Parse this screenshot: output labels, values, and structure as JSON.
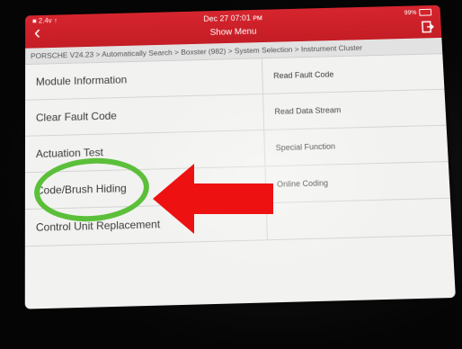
{
  "status_bar": {
    "indicators": "■ 2.4ᴠ ↑",
    "battery": "99%"
  },
  "header": {
    "datetime": "Dec 27  07:01 ᴘᴍ",
    "title": "Show Menu",
    "back_icon": "chevron-left-icon",
    "exit_icon": "exit-icon",
    "color": "#d6252e"
  },
  "breadcrumb": "PORSCHE V24.23 > Automatically Search > Boxster (982) > System Selection > Instrument Cluster",
  "menu": {
    "left": [
      "Module Information",
      "Clear Fault Code",
      "Actuation Test",
      "Code/Brush Hiding",
      "Control Unit Replacement"
    ],
    "right": [
      "Read Fault Code",
      "Read Data Stream",
      "Special Function",
      "Online Coding",
      ""
    ]
  },
  "annotations": {
    "circle_color": "#5cbf3a",
    "arrow_color": "#ee1111",
    "highlighted_item": "Code/Brush Hiding"
  }
}
